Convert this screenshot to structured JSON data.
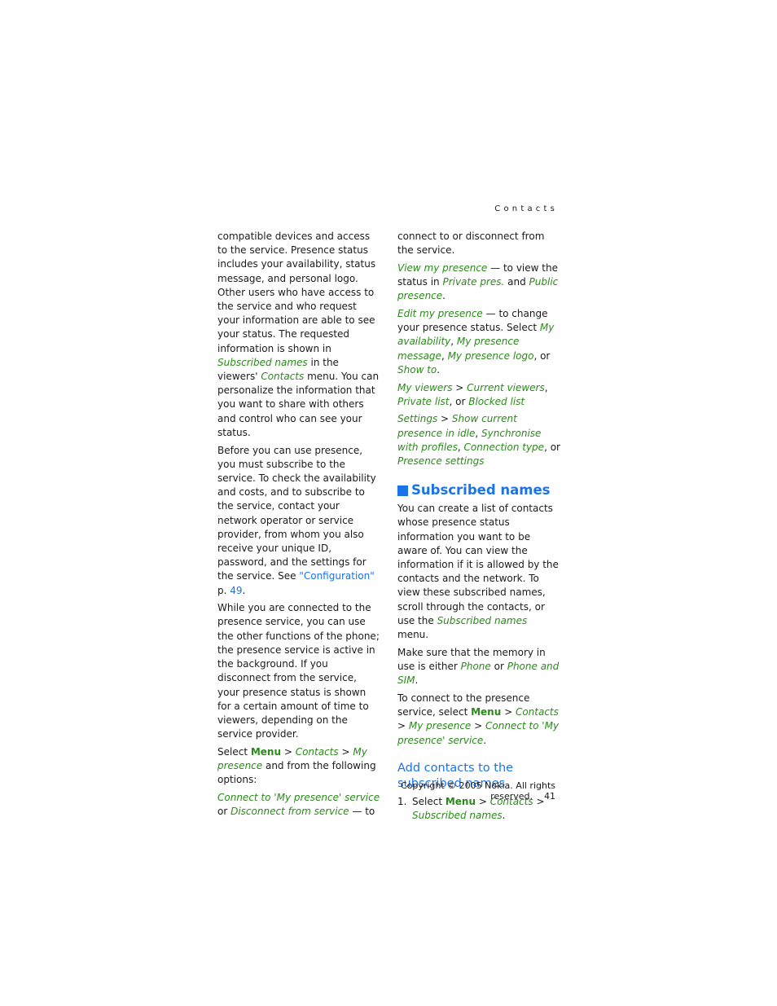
{
  "header": {
    "section": "Contacts"
  },
  "left": {
    "p1": {
      "t1": "compatible devices and access to the service. Presence status includes your availability, status message, and personal logo. Other users who have access to the service and who request your information are able to see your status. The requested information is shown in ",
      "l1": "Subscribed names",
      "t2": " in the viewers' ",
      "l2": "Contacts",
      "t3": " menu. You can personalize the information that you want to share with others and control who can see your status."
    },
    "p2": {
      "t1": "Before you can use presence, you must subscribe to the service. To check the availability and costs, and to subscribe to the service, contact your network operator or service provider, from whom you also receive your unique ID, password, and the settings for the service. See ",
      "ref": "\"Configuration\"",
      "t2": " p. ",
      "page": "49",
      "t3": "."
    },
    "p3": "While you are connected to the presence service, you can use the other functions of the phone; the presence service is active in the background. If you disconnect from the service, your presence status is shown for a certain amount of time to viewers, depending on the service provider.",
    "p4": {
      "t1": "Select ",
      "menu": "Menu",
      "sep1": " > ",
      "contacts": "Contacts",
      "sep2": " > ",
      "mypresence": "My presence",
      "t2": " and from the following options:"
    },
    "p5": {
      "o1": "Connect to 'My presence' service",
      "t1": " or ",
      "o2": "Disconnect from service",
      "t2": " — to"
    }
  },
  "right": {
    "p0": "connect to or disconnect from the service.",
    "view": {
      "label": "View my presence",
      "t1": " — to view the status in ",
      "l1": "Private pres.",
      "t2": " and ",
      "l2": "Public presence",
      "t3": "."
    },
    "edit": {
      "label": "Edit my presence",
      "t1": " — to change your presence status. Select ",
      "l1": "My availability",
      "c1": ", ",
      "l2": "My presence message",
      "c2": ", ",
      "l3": "My presence logo",
      "t2": ", or ",
      "l4": "Show to",
      "t3": "."
    },
    "viewers": {
      "label": "My viewers",
      "sep": " > ",
      "l1": "Current viewers",
      "c1": ", ",
      "l2": "Private list",
      "t1": ", or ",
      "l3": "Blocked list"
    },
    "settings": {
      "label": "Settings",
      "sep": " > ",
      "l1": "Show current presence in idle",
      "c1": ", ",
      "l2": "Synchronise with profiles",
      "c2": ", ",
      "l3": "Connection type",
      "t1": ", or ",
      "l4": "Presence settings"
    },
    "heading": "Subscribed names",
    "s1": {
      "t1": "You can create a list of contacts whose presence status information you want to be aware of. You can view the information if it is allowed by the contacts and the network. To view these subscribed names, scroll through the contacts, or use the ",
      "l1": "Subscribed names",
      "t2": " menu."
    },
    "s2": {
      "t1": "Make sure that the memory in use is either ",
      "l1": "Phone",
      "t2": " or ",
      "l2": "Phone and SIM",
      "t3": "."
    },
    "s3": {
      "t1": "To connect to the presence service, select ",
      "menu": "Menu",
      "sep1": " > ",
      "l1": "Contacts",
      "sep2": " > ",
      "l2": "My presence",
      "sep3": " > ",
      "l3": "Connect to 'My presence' service",
      "t2": "."
    },
    "subheading": "Add contacts to the subscribed names",
    "step1": {
      "num": "1.",
      "t1": "Select ",
      "menu": "Menu",
      "sep1": " > ",
      "l1": "Contacts",
      "sep2": " > ",
      "l2": "Subscribed names",
      "t2": "."
    }
  },
  "footer": {
    "copyright": "Copyright © 2005 Nokia. All rights reserved.",
    "page_number": "41"
  }
}
